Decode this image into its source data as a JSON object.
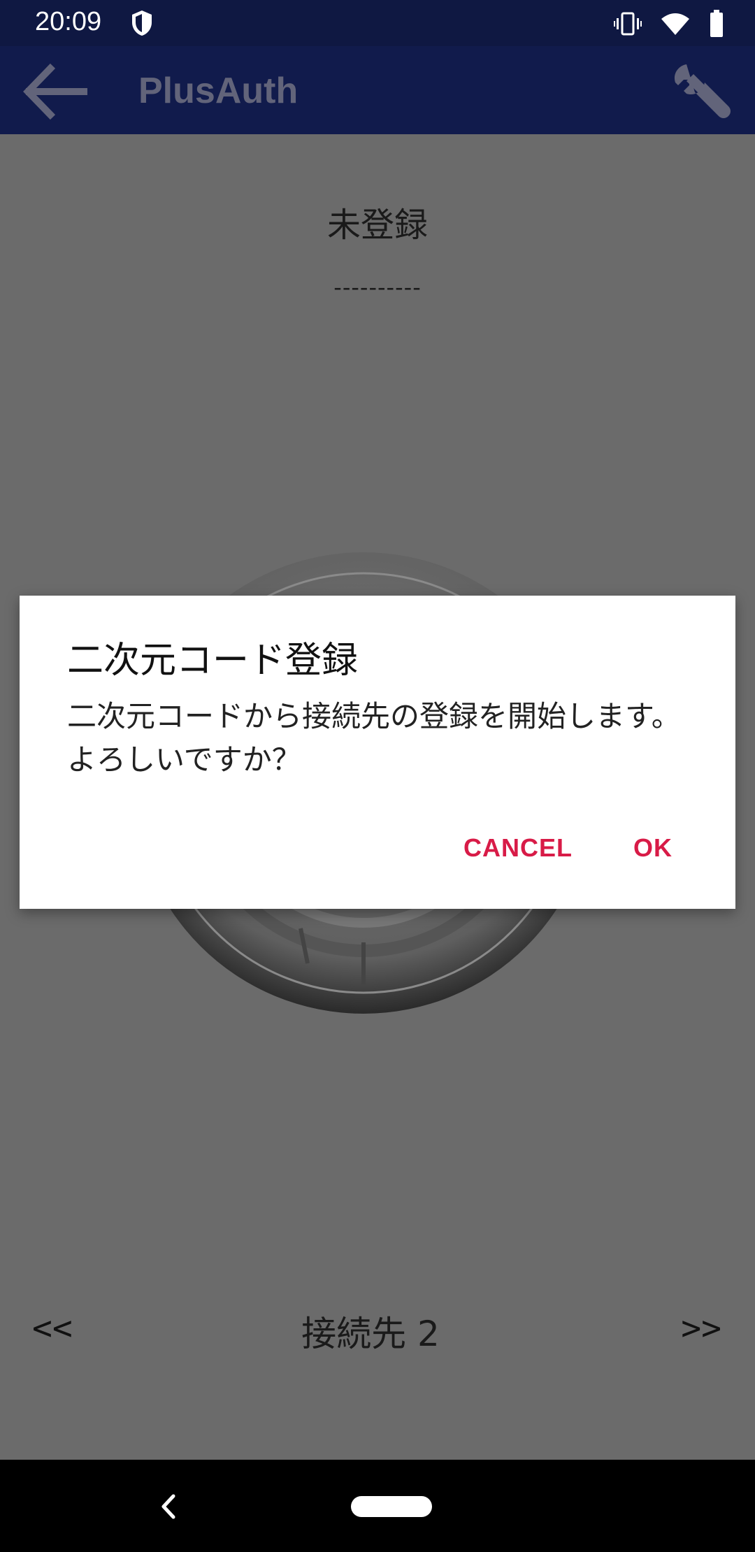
{
  "status_bar": {
    "time": "20:09"
  },
  "app_bar": {
    "title": "PlusAuth",
    "back_icon": "arrow-left-icon",
    "settings_icon": "wrench-icon"
  },
  "main": {
    "status": "未登録",
    "code": "----------",
    "prev": "<<",
    "next": ">>",
    "connection_label": "接続先 2"
  },
  "dialog": {
    "title": "二次元コード登録",
    "message": "二次元コードから接続先の登録を開始します。よろしいですか？",
    "cancel_label": "CANCEL",
    "ok_label": "OK",
    "accent_color": "#d81b47"
  },
  "colors": {
    "status_bar": "#0f1842",
    "app_bar": "#111b4c",
    "scrim": "#6b6b6b"
  }
}
